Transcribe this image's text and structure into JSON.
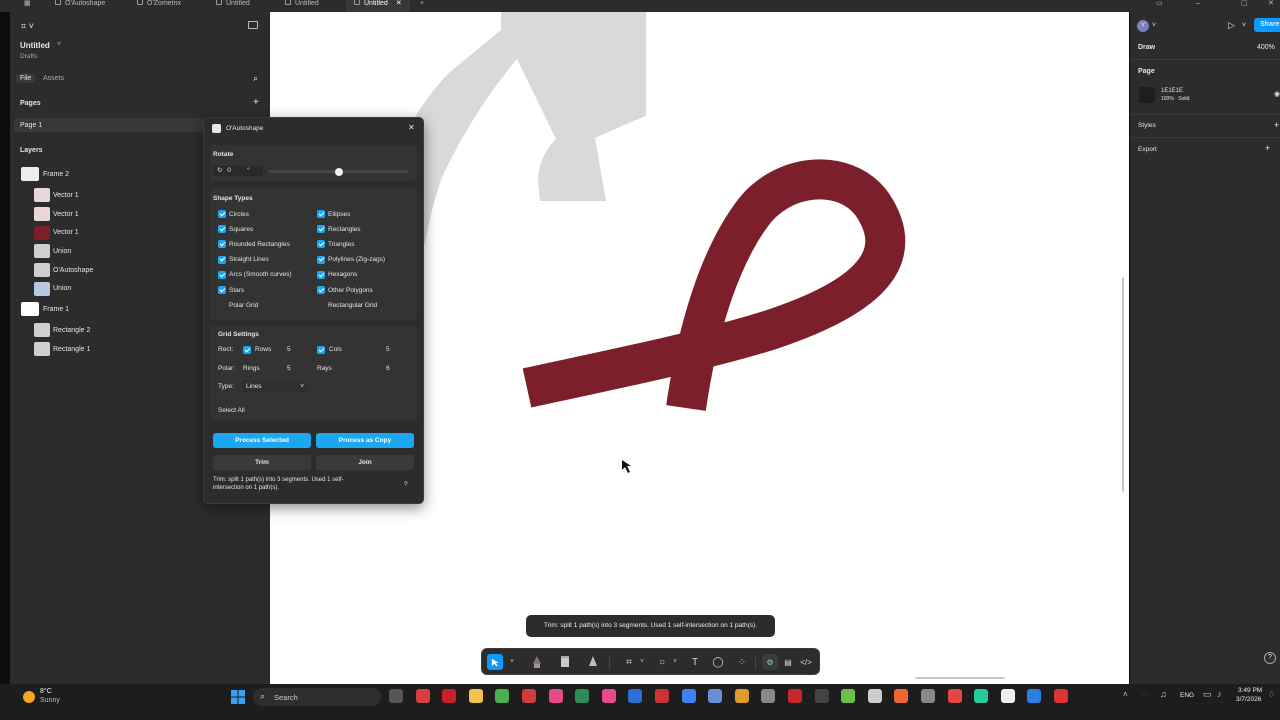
{
  "tabs": [
    {
      "label": "O'Autoshape",
      "active": false
    },
    {
      "label": "O'Zometrix",
      "active": false
    },
    {
      "label": "Untitled",
      "active": false
    },
    {
      "label": "Untitled",
      "active": false
    },
    {
      "label": "Untitled",
      "active": true
    }
  ],
  "file": {
    "title": "Untitled",
    "location": "Drafts"
  },
  "nav": {
    "file_tab": "File",
    "assets_tab": "Assets"
  },
  "pages": {
    "heading": "Pages",
    "items": [
      "Page 1"
    ]
  },
  "layers": {
    "heading": "Layers",
    "items": [
      "Frame 2",
      "Vector 1",
      "Vector 1",
      "Vector 1",
      "Union",
      "O'Autoshape",
      "Union",
      "Frame 1",
      "Rectangle 2",
      "Rectangle 1"
    ]
  },
  "plugin": {
    "title": "O'Autoshape",
    "rotate": {
      "heading": "Rotate",
      "value": "0",
      "unit": "°",
      "slider_fraction": 0.5
    },
    "shape_types": {
      "heading": "Shape Types",
      "items": [
        {
          "label": "Circles",
          "checked": true
        },
        {
          "label": "Ellipses",
          "checked": true
        },
        {
          "label": "Squares",
          "checked": true
        },
        {
          "label": "Rectangles",
          "checked": true
        },
        {
          "label": "Rounded Rectangles",
          "checked": true
        },
        {
          "label": "Triangles",
          "checked": true
        },
        {
          "label": "Straight Lines",
          "checked": true
        },
        {
          "label": "Polylines (Zig-zags)",
          "checked": true
        },
        {
          "label": "Arcs (Smooth curves)",
          "checked": true
        },
        {
          "label": "Hexagons",
          "checked": true
        },
        {
          "label": "Stars",
          "checked": true
        },
        {
          "label": "Other Polygons",
          "checked": true
        },
        {
          "label": "Polar Grid",
          "checked": false
        },
        {
          "label": "Rectangular Grid",
          "checked": false
        }
      ]
    },
    "grid": {
      "heading": "Grid Settings",
      "rect_label": "Rect:",
      "rows_label": "Rows",
      "rows_value": "5",
      "cols_label": "Cols",
      "cols_value": "5",
      "polar_label": "Polar:",
      "rings_label": "Rings",
      "rings_value": "5",
      "rays_label": "Rays",
      "rays_value": "6",
      "type_label": "Type:",
      "type_value": "Lines"
    },
    "select_all": "Select All",
    "process_selected": "Process Selected",
    "process_copy": "Process as Copy",
    "trim": "Trim",
    "join": "Join",
    "status": "Trim: split 1 path(s) into 3 segments. Used 1 self-intersection on 1 path(s).",
    "help": "?"
  },
  "right": {
    "draw_tab": "Draw",
    "zoom": "400%",
    "share": "Share",
    "avatar": "Y",
    "page_heading": "Page",
    "page_color": "1E1E1E",
    "page_fill_desc": "100% · Solid",
    "styles_heading": "Styles",
    "export_heading": "Export"
  },
  "toast": "Trim: split 1 path(s) into 3 segments. Used 1 self-intersection on 1 path(s).",
  "taskbar": {
    "temp": "8°C",
    "weather": "Sunny",
    "search_placeholder": "Search",
    "lang": "ENG",
    "time": "3:49 PM",
    "date": "3/7/2026"
  },
  "colors": {
    "accent": "#1ba8f0",
    "shape": "#7b1f2a",
    "panel": "#2c2c2c",
    "canvas_shape_gray": "#d9d9d9"
  }
}
